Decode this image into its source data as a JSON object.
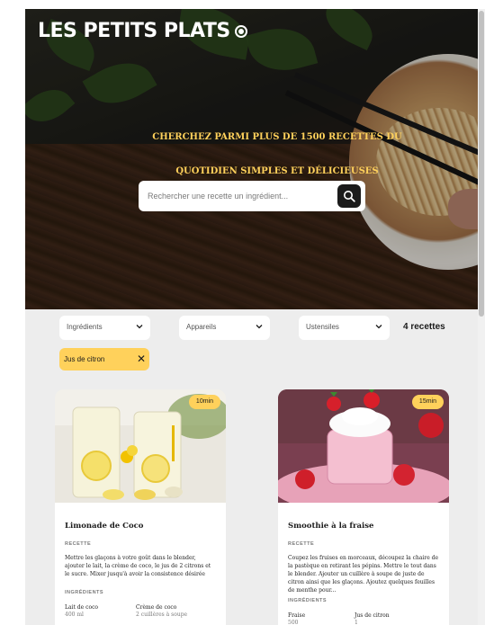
{
  "header": {
    "logo_text": "LES PETITS PLATS",
    "headline_line1": "CHERCHEZ PARMI PLUS DE 1500 RECETTES DU",
    "headline_line2": "QUOTIDIEN SIMPLES ET DÉLICIEUSES",
    "search_placeholder": "Rechercher une recette un ingrédient..."
  },
  "filters": [
    {
      "label": "Ingrédients"
    },
    {
      "label": "Appareils"
    },
    {
      "label": "Ustensiles"
    }
  ],
  "recipe_count": "4 recettes",
  "active_tags": [
    {
      "label": "Jus de citron"
    }
  ],
  "recipes": [
    {
      "time": "10min",
      "title": "Limonade de Coco",
      "recipe_heading": "RECETTE",
      "description": "Mettre les glaçons à votre goût dans le blender, ajouter le lait, la crème de coco, le jus de 2 citrons et le sucre. Mixer jusqu'à avoir la consistence désirée",
      "ingredients_heading": "INGRÉDIENTS",
      "ingredients": [
        {
          "name": "Lait de coco",
          "qty": "400 ml"
        },
        {
          "name": "Crème de coco",
          "qty": "2 cuillères à soupe"
        }
      ]
    },
    {
      "time": "15min",
      "title": "Smoothie à la fraise",
      "recipe_heading": "RECETTE",
      "description": "Coupez les fruises en morceaux, découpez la chaire de la pastèque en retirant les pépins. Mettre le tout dans le blender. Ajouter un cuillère à soupe de juste de citron ainsi que les glaçons. Ajoutez quelques feuilles de menthe pour...",
      "ingredients_heading": "INGRÉDIENTS",
      "ingredients": [
        {
          "name": "Fraise",
          "qty": "500"
        },
        {
          "name": "Jus de citron",
          "qty": "1"
        }
      ]
    }
  ],
  "colors": {
    "accent": "#FFD15B",
    "dark": "#1B1B1B",
    "background": "#EDEDED"
  }
}
